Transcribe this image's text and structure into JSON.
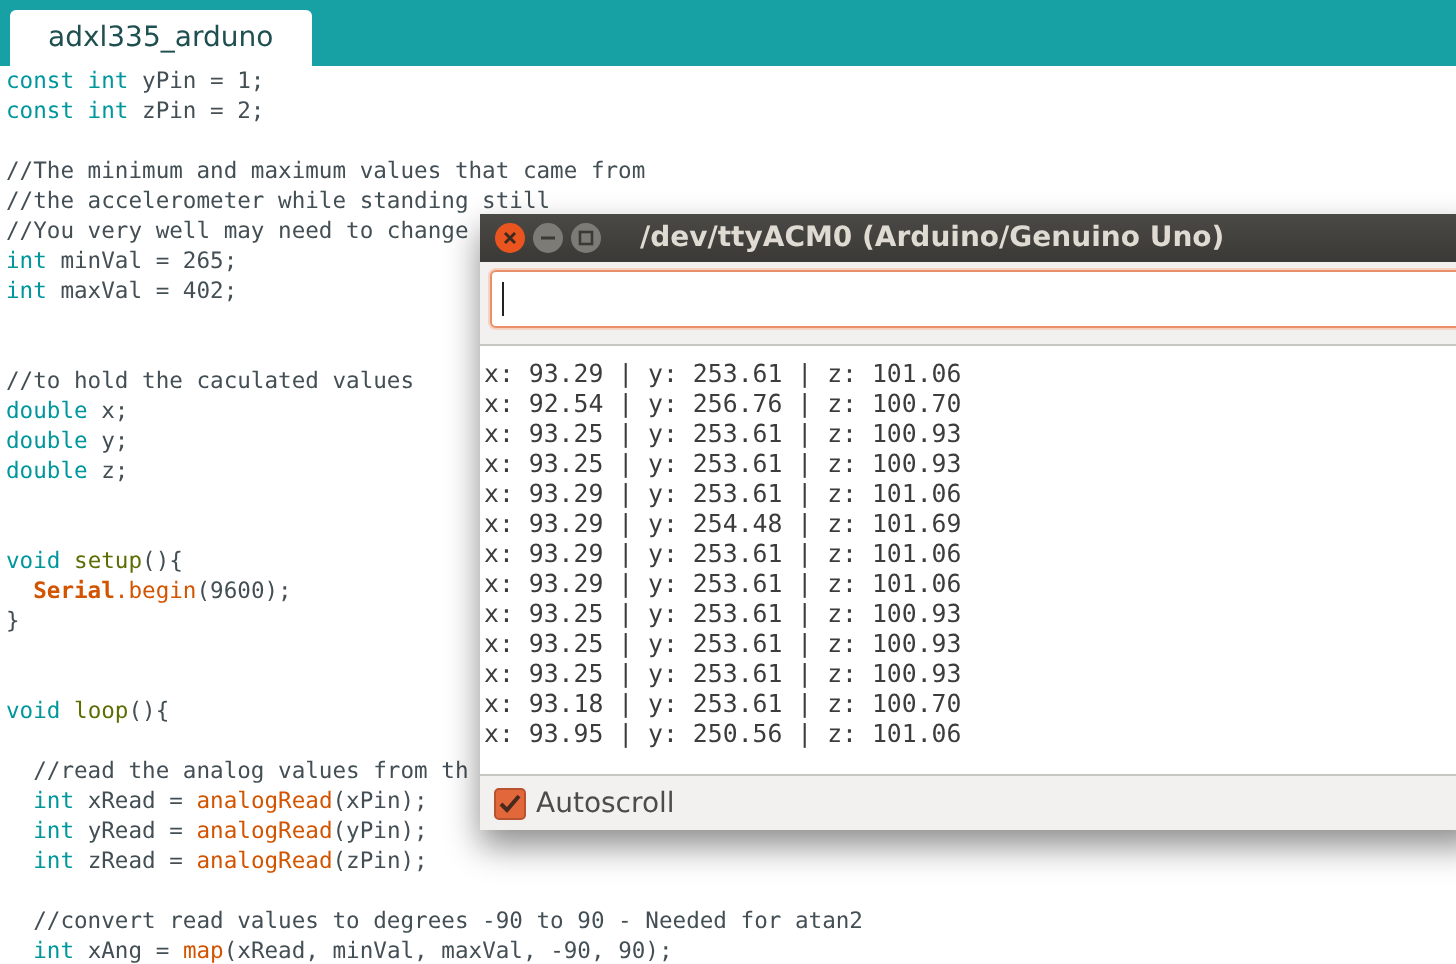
{
  "tab": {
    "label": "adxl335_arduno",
    "selected": true
  },
  "code": [
    {
      "kind": "code",
      "tokens": [
        {
          "kind": "type",
          "text": "const int"
        },
        {
          "kind": "plain",
          "text": " yPin = 1;"
        }
      ]
    },
    {
      "kind": "code",
      "tokens": [
        {
          "kind": "type",
          "text": "const int"
        },
        {
          "kind": "plain",
          "text": " zPin = 2;"
        }
      ]
    },
    {
      "kind": "blank"
    },
    {
      "kind": "code",
      "tokens": [
        {
          "kind": "comment",
          "text": "//The minimum and maximum values that came from"
        }
      ]
    },
    {
      "kind": "code",
      "tokens": [
        {
          "kind": "comment",
          "text": "//the accelerometer while standing still"
        }
      ]
    },
    {
      "kind": "code",
      "tokens": [
        {
          "kind": "comment",
          "text": "//You very well may need to change"
        }
      ]
    },
    {
      "kind": "code",
      "tokens": [
        {
          "kind": "type",
          "text": "int"
        },
        {
          "kind": "plain",
          "text": " minVal = 265;"
        }
      ]
    },
    {
      "kind": "code",
      "tokens": [
        {
          "kind": "type",
          "text": "int"
        },
        {
          "kind": "plain",
          "text": " maxVal = 402;"
        }
      ]
    },
    {
      "kind": "blank"
    },
    {
      "kind": "blank"
    },
    {
      "kind": "code",
      "tokens": [
        {
          "kind": "comment",
          "text": "//to hold the caculated values"
        }
      ]
    },
    {
      "kind": "code",
      "tokens": [
        {
          "kind": "type",
          "text": "double"
        },
        {
          "kind": "plain",
          "text": " x;"
        }
      ]
    },
    {
      "kind": "code",
      "tokens": [
        {
          "kind": "type",
          "text": "double"
        },
        {
          "kind": "plain",
          "text": " y;"
        }
      ]
    },
    {
      "kind": "code",
      "tokens": [
        {
          "kind": "type",
          "text": "double"
        },
        {
          "kind": "plain",
          "text": " z;"
        }
      ]
    },
    {
      "kind": "blank"
    },
    {
      "kind": "blank"
    },
    {
      "kind": "code",
      "tokens": [
        {
          "kind": "type",
          "text": "void"
        },
        {
          "kind": "entry",
          "text": " setup"
        },
        {
          "kind": "plain",
          "text": "(){"
        }
      ]
    },
    {
      "kind": "code",
      "tokens": [
        {
          "kind": "class",
          "text": "  Serial"
        },
        {
          "kind": "func",
          "text": ".begin"
        },
        {
          "kind": "plain",
          "text": "(9600);"
        }
      ]
    },
    {
      "kind": "code",
      "tokens": [
        {
          "kind": "plain",
          "text": "}"
        }
      ]
    },
    {
      "kind": "blank"
    },
    {
      "kind": "blank"
    },
    {
      "kind": "code",
      "tokens": [
        {
          "kind": "type",
          "text": "void"
        },
        {
          "kind": "entry",
          "text": " loop"
        },
        {
          "kind": "plain",
          "text": "(){"
        }
      ]
    },
    {
      "kind": "blank"
    },
    {
      "kind": "code",
      "tokens": [
        {
          "kind": "comment",
          "text": "  //read the analog values from th"
        }
      ]
    },
    {
      "kind": "code",
      "tokens": [
        {
          "kind": "type",
          "text": "  int"
        },
        {
          "kind": "plain",
          "text": " xRead = "
        },
        {
          "kind": "func",
          "text": "analogRead"
        },
        {
          "kind": "plain",
          "text": "(xPin);"
        }
      ]
    },
    {
      "kind": "code",
      "tokens": [
        {
          "kind": "type",
          "text": "  int"
        },
        {
          "kind": "plain",
          "text": " yRead = "
        },
        {
          "kind": "func",
          "text": "analogRead"
        },
        {
          "kind": "plain",
          "text": "(yPin);"
        }
      ]
    },
    {
      "kind": "code",
      "tokens": [
        {
          "kind": "type",
          "text": "  int"
        },
        {
          "kind": "plain",
          "text": " zRead = "
        },
        {
          "kind": "func",
          "text": "analogRead"
        },
        {
          "kind": "plain",
          "text": "(zPin);"
        }
      ]
    },
    {
      "kind": "blank"
    },
    {
      "kind": "code",
      "tokens": [
        {
          "kind": "comment",
          "text": "  //convert read values to degrees -90 to 90 - Needed for atan2"
        }
      ]
    },
    {
      "kind": "code",
      "tokens": [
        {
          "kind": "type",
          "text": "  int"
        },
        {
          "kind": "plain",
          "text": " xAng = "
        },
        {
          "kind": "func",
          "text": "map"
        },
        {
          "kind": "plain",
          "text": "(xRead, minVal, maxVal, -90, 90);"
        }
      ]
    }
  ],
  "serial_monitor": {
    "title": "/dev/ttyACM0 (Arduino/Genuino Uno)",
    "output": [
      "x: 93.29 | y: 253.61 | z: 101.06",
      "x: 92.54 | y: 256.76 | z: 100.70",
      "x: 93.25 | y: 253.61 | z: 100.93",
      "x: 93.25 | y: 253.61 | z: 100.93",
      "x: 93.29 | y: 253.61 | z: 101.06",
      "x: 93.29 | y: 254.48 | z: 101.69",
      "x: 93.29 | y: 253.61 | z: 101.06",
      "x: 93.29 | y: 253.61 | z: 101.06",
      "x: 93.25 | y: 253.61 | z: 100.93",
      "x: 93.25 | y: 253.61 | z: 100.93",
      "x: 93.25 | y: 253.61 | z: 100.93",
      "x: 93.18 | y: 253.61 | z: 100.70",
      "x: 93.95 | y: 250.56 | z: 101.06"
    ],
    "autoscroll": {
      "label": "Autoscroll",
      "checked": true
    }
  }
}
